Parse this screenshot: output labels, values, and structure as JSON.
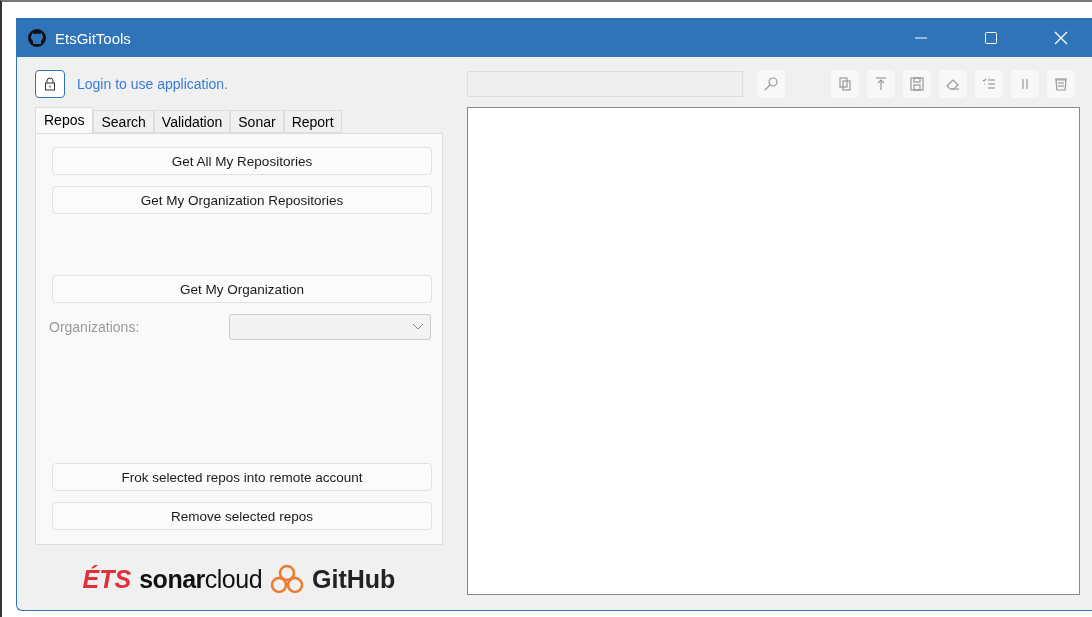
{
  "window": {
    "title": "EtsGitTools"
  },
  "login": {
    "text": "Login to use application."
  },
  "tabs": [
    {
      "label": "Repos",
      "selected": true
    },
    {
      "label": "Search",
      "selected": false
    },
    {
      "label": "Validation",
      "selected": false
    },
    {
      "label": "Sonar",
      "selected": false
    },
    {
      "label": "Report",
      "selected": false
    }
  ],
  "repos_panel": {
    "items": [
      {
        "kind": "button",
        "label": "Get All My Repositories"
      },
      {
        "kind": "button",
        "label": "Get My Organization Repositories"
      },
      {
        "kind": "gap"
      },
      {
        "kind": "button",
        "label": "Get My Organization"
      },
      {
        "kind": "select",
        "label": "Organizations:",
        "disabled": true
      },
      {
        "kind": "spacer"
      },
      {
        "kind": "button",
        "label": "Frok selected repos into remote account"
      },
      {
        "kind": "button",
        "label": "Remove selected repos"
      }
    ]
  },
  "logos": {
    "ets": "ÉTS",
    "sonar_bold": "sonar",
    "sonar_light": "cloud",
    "github": "GitHub"
  }
}
